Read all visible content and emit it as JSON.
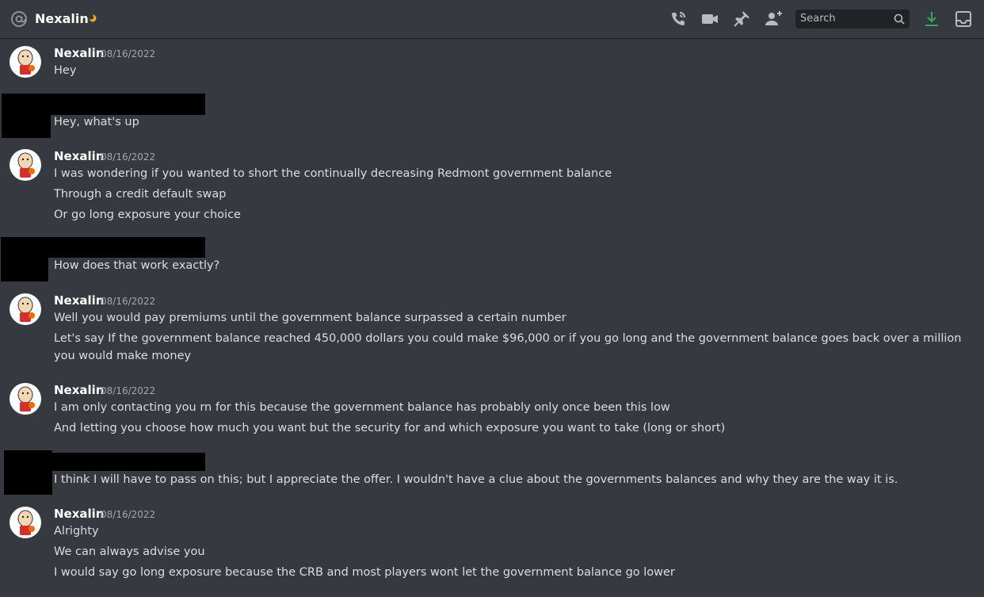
{
  "header": {
    "title": "Nexalin",
    "status_icon": "idle-moon-icon",
    "search_placeholder": "Search"
  },
  "messages": [
    {
      "author": "Nexalin",
      "timestamp": "08/16/2022",
      "lines": [
        "Hey"
      ]
    },
    {
      "author": "",
      "redacted": true,
      "lines": [
        "Hey, what's up"
      ]
    },
    {
      "author": "Nexalin",
      "timestamp": "08/16/2022",
      "lines": [
        "I was wondering if you wanted to short the continually  decreasing Redmont government balance",
        "Through a credit default swap",
        "Or go long exposure your choice"
      ]
    },
    {
      "author": "",
      "redacted": true,
      "lines": [
        "How does that work exactly?"
      ]
    },
    {
      "author": "Nexalin",
      "timestamp": "08/16/2022",
      "lines": [
        "Well you would pay premiums until the government balance surpassed a certain number",
        "Let's say If the government balance reached 450,000 dollars you could make $96,000 or if you go long and the government balance goes back over a million you would make money"
      ]
    },
    {
      "author": "Nexalin",
      "timestamp": "08/16/2022",
      "lines": [
        "I am only contacting you rn for this because the government balance has probably only once been this low",
        "And letting you choose how much you want but the security for and which exposure you want to take (long or short)"
      ]
    },
    {
      "author": "",
      "redacted": true,
      "lines": [
        "I think I will have to pass on this; but I appreciate the offer. I wouldn't have a clue about the governments balances and why they are the way it is."
      ]
    },
    {
      "author": "Nexalin",
      "timestamp": "08/16/2022",
      "lines": [
        "Alrighty",
        "We can always advise you",
        "I would say go long exposure because the CRB  and most players wont let the government balance go lower"
      ]
    }
  ],
  "colors": {
    "background": "#36393f",
    "text": "#dcddde",
    "username": "#ffffff",
    "timestamp": "#a3a6aa",
    "download_green": "#3ba55d",
    "idle_yellow": "#faa81a"
  }
}
